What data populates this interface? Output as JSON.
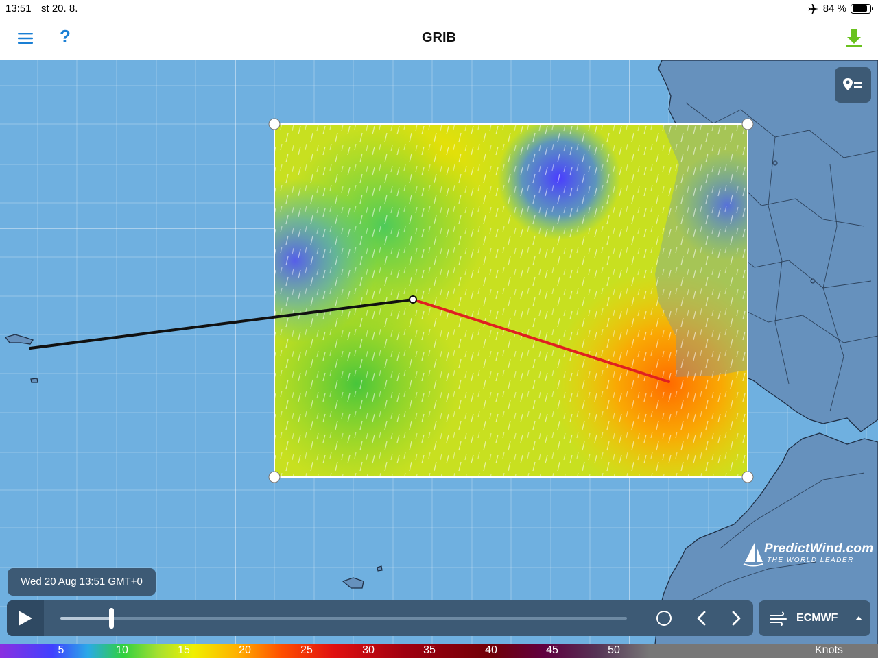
{
  "status_bar": {
    "time": "13:51",
    "date": "st 20. 8.",
    "airplane_mode_icon": "airplane-icon",
    "battery_text": "84 %",
    "battery_level": 0.84
  },
  "nav": {
    "title": "GRIB",
    "menu_icon": "hamburger-menu-icon",
    "help_label": "?",
    "download_icon": "download-arrow-icon",
    "accent_color": "#1a7fd4",
    "download_color": "#6ac21e"
  },
  "map": {
    "brand_name": "PredictWind.com",
    "brand_tagline": "THE WORLD LEADER",
    "layers_icon": "pin-list-icon",
    "route_colors": {
      "first_leg": "#111111",
      "second_leg": "#e02020"
    }
  },
  "timeline": {
    "current_datetime": "Wed 20 Aug 13:51 GMT+0",
    "progress": 0.09,
    "play_icon": "play-icon",
    "now_icon": "circle-now-icon",
    "prev_icon": "chevron-left-icon",
    "next_icon": "chevron-right-icon"
  },
  "model_selector": {
    "label": "ECMWF",
    "icon": "wind-icon",
    "caret_icon": "caret-up-icon"
  },
  "legend": {
    "ticks": [
      "5",
      "10",
      "15",
      "20",
      "25",
      "30",
      "35",
      "40",
      "45",
      "50"
    ],
    "unit": "Knots"
  }
}
